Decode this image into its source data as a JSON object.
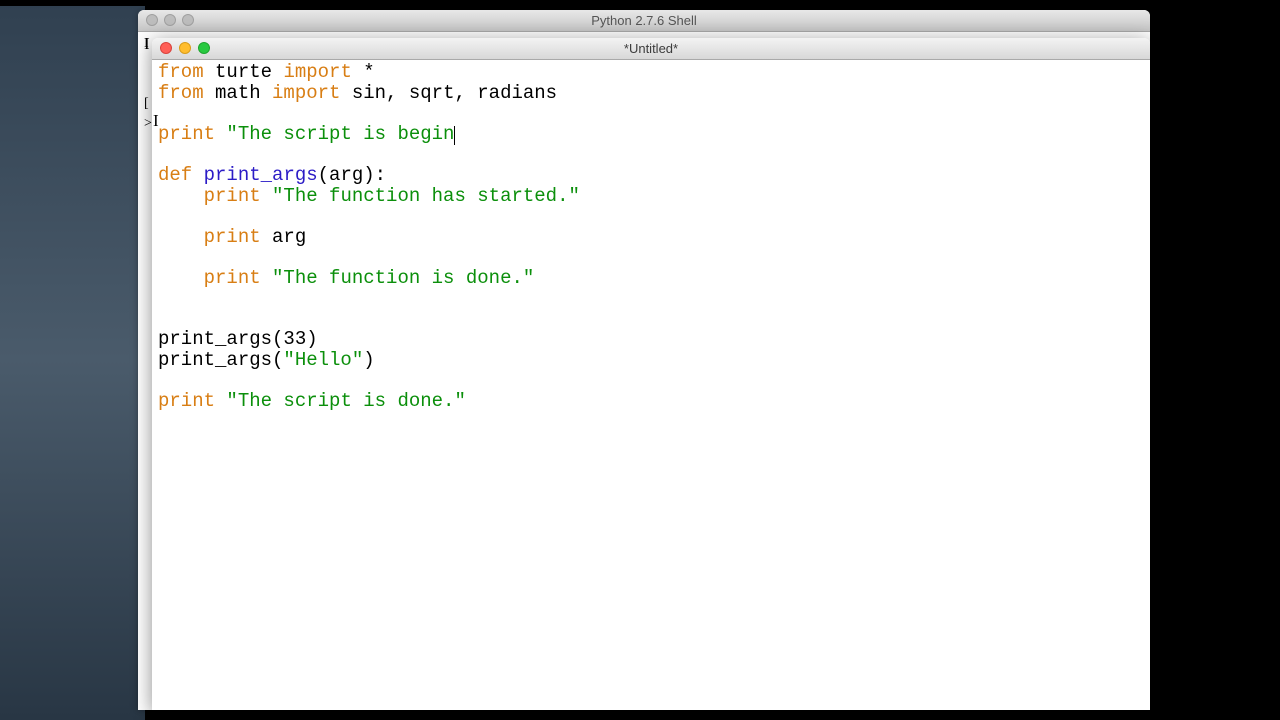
{
  "backWindow": {
    "title": "Python 2.7.6 Shell",
    "peekLine1": "I",
    "peekLine2": "[",
    "peekLine3": ">"
  },
  "frontWindow": {
    "title": "*Untitled*"
  },
  "code": {
    "l1a": "from",
    "l1b": " turte ",
    "l1c": "import",
    "l1d": " *",
    "l2a": "from",
    "l2b": " math ",
    "l2c": "import",
    "l2d": " sin, sqrt, radians",
    "l3": "",
    "l4a": "print",
    "l4b": " ",
    "l4c": "\"The script is begin",
    "l5": "",
    "l6a": "def",
    "l6b": " ",
    "l6c": "print_args",
    "l6d": "(arg):",
    "l7a": "    ",
    "l7b": "print",
    "l7c": " ",
    "l7d": "\"The function has started.\"",
    "l8": "",
    "l9a": "    ",
    "l9b": "print",
    "l9c": " arg",
    "l10": "",
    "l11a": "    ",
    "l11b": "print",
    "l11c": " ",
    "l11d": "\"The function is done.\"",
    "l12": "",
    "l13": "",
    "l14a": "print_args(33)",
    "l15a": "print_args(",
    "l15b": "\"Hello\"",
    "l15c": ")",
    "l16": "",
    "l17a": "print",
    "l17b": " ",
    "l17c": "\"The script is done.\""
  },
  "ibeam1": "I",
  "ibeam2": "I"
}
